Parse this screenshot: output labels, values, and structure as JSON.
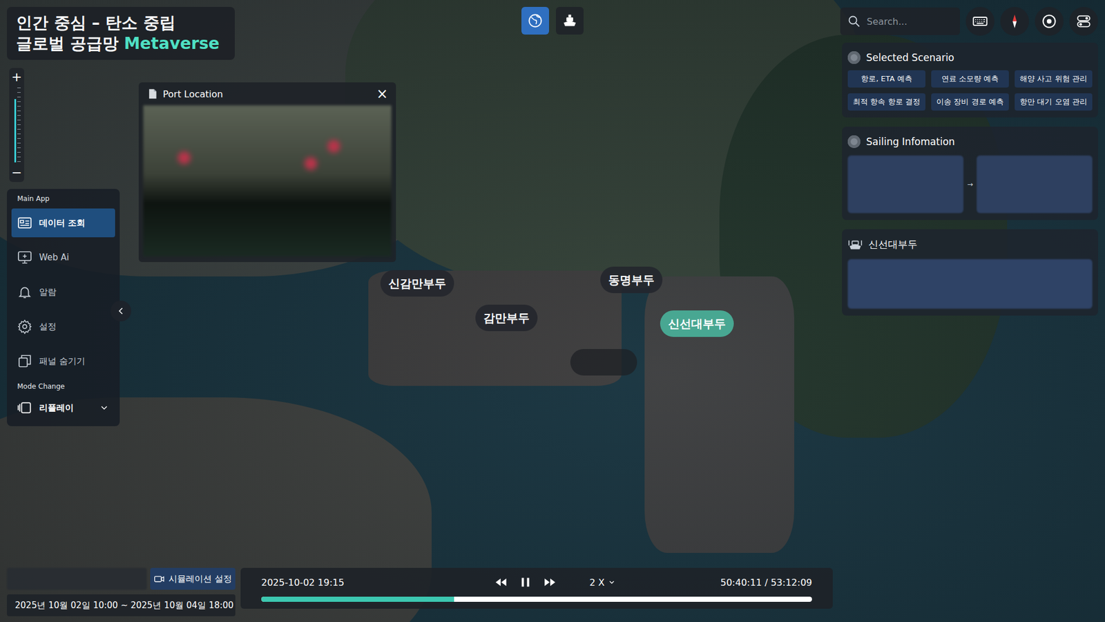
{
  "title": {
    "line1": "인간 중심 – 탄소 중립",
    "line2": "글로벌 공급망",
    "accent": "Metaverse"
  },
  "zoom": {
    "plus": "+",
    "minus": "−",
    "level": 0.85
  },
  "sidebar": {
    "section": "Main App",
    "items": [
      {
        "label": "데이터 조회",
        "kind": "data",
        "selected": true
      },
      {
        "label": "Web Ai",
        "kind": "webai",
        "selected": false
      },
      {
        "label": "알람",
        "kind": "bell",
        "selected": false
      },
      {
        "label": "설정",
        "kind": "gear",
        "selected": false
      },
      {
        "label": "패널 숨기기",
        "kind": "hide",
        "selected": false
      }
    ],
    "mode_section": "Mode Change",
    "mode": {
      "label": "리플레이",
      "expanded": false
    }
  },
  "popup": {
    "title": "Port Location",
    "close": "×"
  },
  "top_buttons": [
    {
      "kind": "globe",
      "selected": true
    },
    {
      "kind": "ship",
      "selected": false
    }
  ],
  "search": {
    "placeholder": "Search..."
  },
  "scenario": {
    "title": "Selected Scenario",
    "buttons": [
      {
        "label": "항로, ETA 예측",
        "selected": false
      },
      {
        "label": "연료 소모량 예측",
        "selected": false
      },
      {
        "label": "해양 사고 위험 관리",
        "selected": false
      },
      {
        "label": "최적 항속 항로 결정",
        "selected": false
      },
      {
        "label": "이송 장비 경로 예측",
        "selected": false
      },
      {
        "label": "항만 대기 오염 관리",
        "selected": false
      }
    ]
  },
  "sailing": {
    "title": "Sailing Infomation",
    "arrow": "→"
  },
  "terminal_panel": {
    "title": "신선대부두"
  },
  "map_labels": [
    {
      "label": "신감만부두",
      "kind": "label",
      "selected": false
    },
    {
      "label": "동명부두",
      "kind": "label",
      "selected": false
    },
    {
      "label": "감만부두",
      "kind": "label",
      "selected": false
    },
    {
      "label": "신선대부두",
      "kind": "label",
      "selected": true
    },
    {
      "label": "",
      "kind": "blurred",
      "selected": false
    }
  ],
  "simulation": {
    "button": "시뮬레이션 설정",
    "range": "2025년 10월 02일 10:00 ~ 2025년 10월 04일 18:00"
  },
  "playback": {
    "time": "2025-10-02 19:15",
    "speed": "2 X",
    "elapsed": "50:40:11 / 53:12:09",
    "playing": true,
    "level": 0.35
  }
}
